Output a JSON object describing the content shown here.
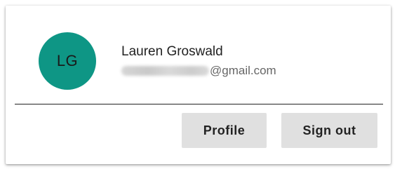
{
  "user": {
    "initials": "LG",
    "name": "Lauren Groswald",
    "email_domain": "@gmail.com",
    "avatar_color": "#0e9685"
  },
  "actions": {
    "profile_label": "Profile",
    "signout_label": "Sign out"
  }
}
